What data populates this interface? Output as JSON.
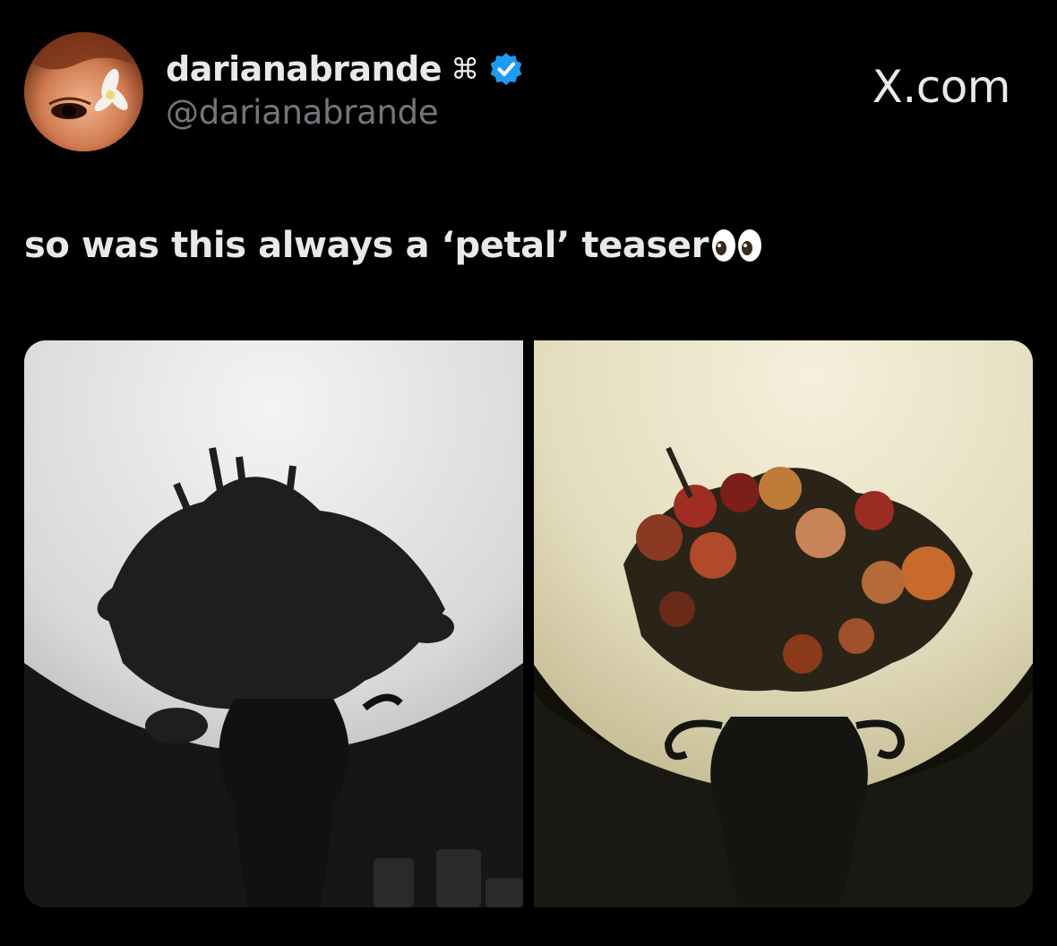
{
  "post": {
    "author": {
      "display_name": "darianabrande",
      "name_symbol": "⌘",
      "handle": "@darianabrande",
      "verified": true,
      "avatar_icon": "avatar-photo"
    },
    "site_label": "X.com",
    "text": "so was this always a ‘petal’ teaser",
    "text_emoji": "eyes-icon",
    "media": [
      {
        "icon": "flower-vase-photo",
        "tone": "black-and-white"
      },
      {
        "icon": "flower-vase-photo",
        "tone": "warm-color"
      }
    ]
  },
  "colors": {
    "background": "#000000",
    "primary_text": "#e7e9ea",
    "secondary_text": "#71767b",
    "verified_blue": "#1d9bf0"
  }
}
